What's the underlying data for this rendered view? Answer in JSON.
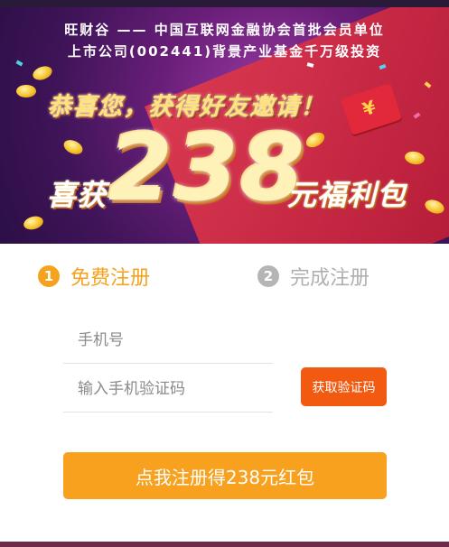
{
  "banner": {
    "line1": "旺财谷 —— 中国互联网金融协会首批会员单位",
    "line2": "上市公司(002441)背景产业基金千万级投资",
    "congrats": "恭喜您，获得好友邀请！",
    "prefix": "喜获",
    "amount": "238",
    "suffix": "元福利包",
    "envelope_icon": "red-envelope-icon"
  },
  "steps": [
    {
      "number": "1",
      "label": "免费注册",
      "active": true
    },
    {
      "number": "2",
      "label": "完成注册",
      "active": false
    }
  ],
  "form": {
    "phone_placeholder": "手机号",
    "phone_value": "",
    "code_placeholder": "输入手机验证码",
    "code_value": "",
    "get_code_label": "获取验证码",
    "submit_label": "点我注册得238元红包"
  },
  "colors": {
    "accent_orange": "#f7a11e",
    "button_red_orange": "#f25a12",
    "inactive_gray": "#b5b5b5",
    "banner_purple": "#6a1f7a",
    "banner_red": "#e03a4e"
  }
}
